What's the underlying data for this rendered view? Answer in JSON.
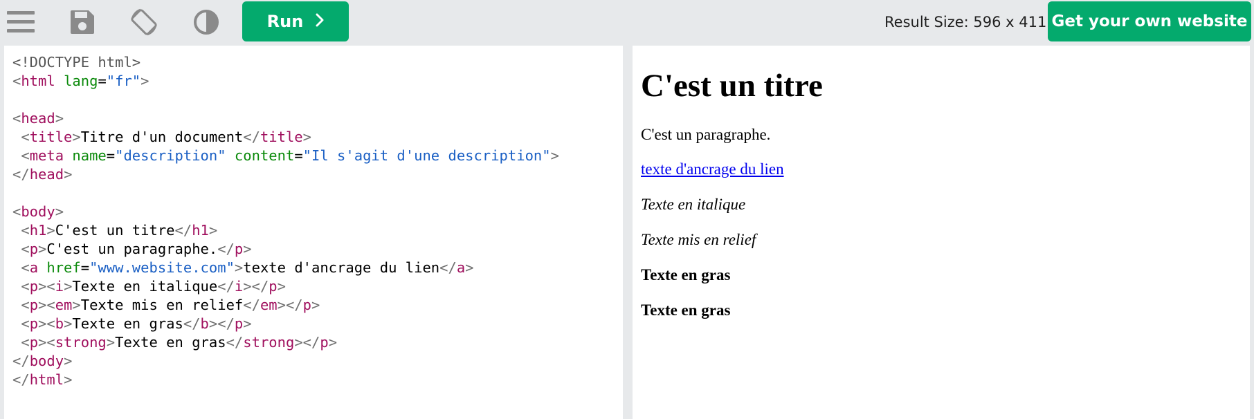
{
  "toolbar": {
    "icons": [
      "menu-icon",
      "save-icon",
      "rotate-icon",
      "contrast-icon"
    ],
    "run_label": "Run",
    "result_size": "Result Size: 596 x 411",
    "get_website_label": "Get your own website",
    "accent_color": "#04aa6d"
  },
  "editor": {
    "lines": [
      [
        [
          "d",
          "<!DOCTYPE html>"
        ]
      ],
      [
        [
          "b",
          "<"
        ],
        [
          "t",
          "html"
        ],
        [
          "tx",
          " "
        ],
        [
          "a",
          "lang"
        ],
        [
          "tx",
          "="
        ],
        [
          "v",
          "\"fr\""
        ],
        [
          "b",
          ">"
        ]
      ],
      [],
      [
        [
          "b",
          "<"
        ],
        [
          "t",
          "head"
        ],
        [
          "b",
          ">"
        ]
      ],
      [
        [
          "tx",
          " "
        ],
        [
          "b",
          "<"
        ],
        [
          "t",
          "title"
        ],
        [
          "b",
          ">"
        ],
        [
          "tx",
          "Titre d'un document"
        ],
        [
          "b",
          "</"
        ],
        [
          "t",
          "title"
        ],
        [
          "b",
          ">"
        ]
      ],
      [
        [
          "tx",
          " "
        ],
        [
          "b",
          "<"
        ],
        [
          "t",
          "meta"
        ],
        [
          "tx",
          " "
        ],
        [
          "a",
          "name"
        ],
        [
          "tx",
          "="
        ],
        [
          "v",
          "\"description\""
        ],
        [
          "tx",
          " "
        ],
        [
          "a",
          "content"
        ],
        [
          "tx",
          "="
        ],
        [
          "v",
          "\"Il s'agit d'une description\""
        ],
        [
          "b",
          ">"
        ]
      ],
      [
        [
          "b",
          "</"
        ],
        [
          "t",
          "head"
        ],
        [
          "b",
          ">"
        ]
      ],
      [],
      [
        [
          "b",
          "<"
        ],
        [
          "t",
          "body"
        ],
        [
          "b",
          ">"
        ]
      ],
      [
        [
          "tx",
          " "
        ],
        [
          "b",
          "<"
        ],
        [
          "t",
          "h1"
        ],
        [
          "b",
          ">"
        ],
        [
          "tx",
          "C'est un titre"
        ],
        [
          "b",
          "</"
        ],
        [
          "t",
          "h1"
        ],
        [
          "b",
          ">"
        ]
      ],
      [
        [
          "tx",
          " "
        ],
        [
          "b",
          "<"
        ],
        [
          "t",
          "p"
        ],
        [
          "b",
          ">"
        ],
        [
          "tx",
          "C'est un paragraphe."
        ],
        [
          "b",
          "</"
        ],
        [
          "t",
          "p"
        ],
        [
          "b",
          ">"
        ]
      ],
      [
        [
          "tx",
          " "
        ],
        [
          "b",
          "<"
        ],
        [
          "t",
          "a"
        ],
        [
          "tx",
          " "
        ],
        [
          "a",
          "href"
        ],
        [
          "tx",
          "="
        ],
        [
          "v",
          "\"www.website.com\""
        ],
        [
          "b",
          ">"
        ],
        [
          "tx",
          "texte d'ancrage du lien"
        ],
        [
          "b",
          "</"
        ],
        [
          "t",
          "a"
        ],
        [
          "b",
          ">"
        ]
      ],
      [
        [
          "tx",
          " "
        ],
        [
          "b",
          "<"
        ],
        [
          "t",
          "p"
        ],
        [
          "b",
          "><"
        ],
        [
          "t",
          "i"
        ],
        [
          "b",
          ">"
        ],
        [
          "tx",
          "Texte en italique"
        ],
        [
          "b",
          "</"
        ],
        [
          "t",
          "i"
        ],
        [
          "b",
          "></"
        ],
        [
          "t",
          "p"
        ],
        [
          "b",
          ">"
        ]
      ],
      [
        [
          "tx",
          " "
        ],
        [
          "b",
          "<"
        ],
        [
          "t",
          "p"
        ],
        [
          "b",
          "><"
        ],
        [
          "t",
          "em"
        ],
        [
          "b",
          ">"
        ],
        [
          "tx",
          "Texte mis en relief"
        ],
        [
          "b",
          "</"
        ],
        [
          "t",
          "em"
        ],
        [
          "b",
          "></"
        ],
        [
          "t",
          "p"
        ],
        [
          "b",
          ">"
        ]
      ],
      [
        [
          "tx",
          " "
        ],
        [
          "b",
          "<"
        ],
        [
          "t",
          "p"
        ],
        [
          "b",
          "><"
        ],
        [
          "t",
          "b"
        ],
        [
          "b",
          ">"
        ],
        [
          "tx",
          "Texte en gras"
        ],
        [
          "b",
          "</"
        ],
        [
          "t",
          "b"
        ],
        [
          "b",
          "></"
        ],
        [
          "t",
          "p"
        ],
        [
          "b",
          ">"
        ]
      ],
      [
        [
          "tx",
          " "
        ],
        [
          "b",
          "<"
        ],
        [
          "t",
          "p"
        ],
        [
          "b",
          "><"
        ],
        [
          "t",
          "strong"
        ],
        [
          "b",
          ">"
        ],
        [
          "tx",
          "Texte en gras"
        ],
        [
          "b",
          "</"
        ],
        [
          "t",
          "strong"
        ],
        [
          "b",
          "></"
        ],
        [
          "t",
          "p"
        ],
        [
          "b",
          ">"
        ]
      ],
      [
        [
          "b",
          "</"
        ],
        [
          "t",
          "body"
        ],
        [
          "b",
          ">"
        ]
      ],
      [
        [
          "b",
          "</"
        ],
        [
          "t",
          "html"
        ],
        [
          "b",
          ">"
        ]
      ]
    ]
  },
  "result": {
    "heading": "C'est un titre",
    "paragraph": "C'est un paragraphe.",
    "link_text": "texte d'ancrage du lien",
    "italic_text": "Texte en italique",
    "emphasis_text": "Texte mis en relief",
    "bold_text": "Texte en gras",
    "strong_text": "Texte en gras",
    "link_color": "#0000ee"
  }
}
